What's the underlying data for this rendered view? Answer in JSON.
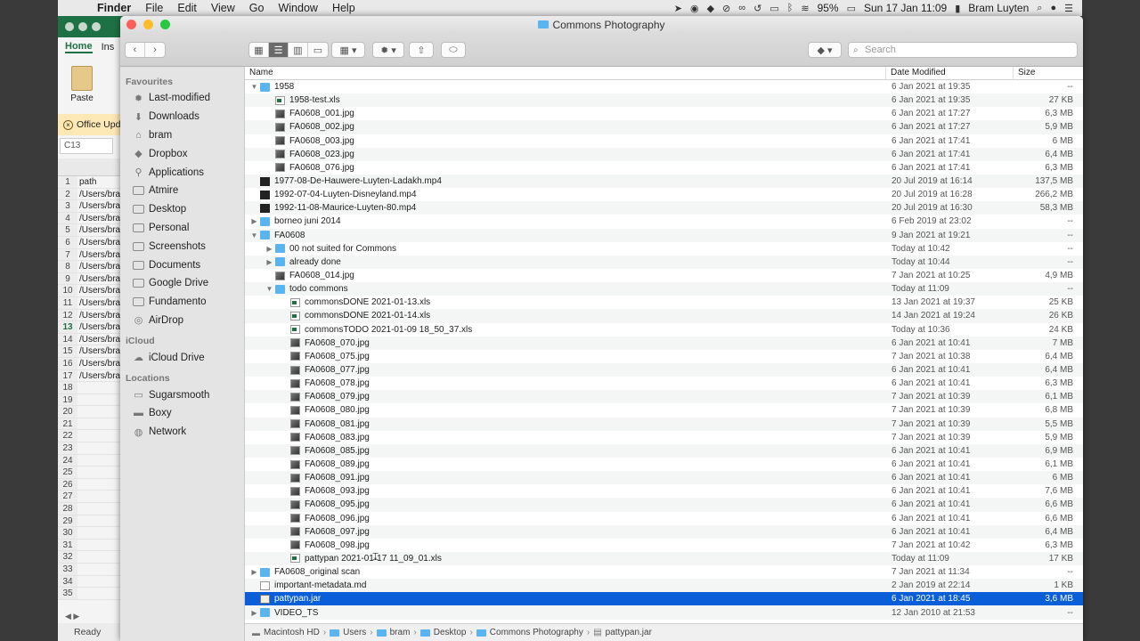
{
  "menubar": {
    "app": "Finder",
    "items": [
      "File",
      "Edit",
      "View",
      "Go",
      "Window",
      "Help"
    ],
    "battery": "95%",
    "clock": "Sun 17 Jan  11:09",
    "user": "Bram Luyten"
  },
  "excel": {
    "tabs": [
      "Home",
      "Ins"
    ],
    "paste_label": "Paste",
    "notice": "Office Upd",
    "namebox": "C13",
    "rows": [
      {
        "n": "1",
        "v": "path"
      },
      {
        "n": "2",
        "v": "/Users/bra"
      },
      {
        "n": "3",
        "v": "/Users/bra"
      },
      {
        "n": "4",
        "v": "/Users/bra"
      },
      {
        "n": "5",
        "v": "/Users/bra"
      },
      {
        "n": "6",
        "v": "/Users/bra"
      },
      {
        "n": "7",
        "v": "/Users/bra"
      },
      {
        "n": "8",
        "v": "/Users/bra"
      },
      {
        "n": "9",
        "v": "/Users/bra"
      },
      {
        "n": "10",
        "v": "/Users/bra"
      },
      {
        "n": "11",
        "v": "/Users/bra"
      },
      {
        "n": "12",
        "v": "/Users/bra"
      },
      {
        "n": "13",
        "v": "/Users/bra"
      },
      {
        "n": "14",
        "v": "/Users/bra"
      },
      {
        "n": "15",
        "v": "/Users/bra"
      },
      {
        "n": "16",
        "v": "/Users/bra"
      },
      {
        "n": "17",
        "v": "/Users/bra"
      },
      {
        "n": "18",
        "v": ""
      },
      {
        "n": "19",
        "v": ""
      },
      {
        "n": "20",
        "v": ""
      },
      {
        "n": "21",
        "v": ""
      },
      {
        "n": "22",
        "v": ""
      },
      {
        "n": "23",
        "v": ""
      },
      {
        "n": "24",
        "v": ""
      },
      {
        "n": "25",
        "v": ""
      },
      {
        "n": "26",
        "v": ""
      },
      {
        "n": "27",
        "v": ""
      },
      {
        "n": "28",
        "v": ""
      },
      {
        "n": "29",
        "v": ""
      },
      {
        "n": "30",
        "v": ""
      },
      {
        "n": "31",
        "v": ""
      },
      {
        "n": "32",
        "v": ""
      },
      {
        "n": "33",
        "v": ""
      },
      {
        "n": "34",
        "v": ""
      },
      {
        "n": "35",
        "v": ""
      }
    ],
    "status": "Ready"
  },
  "window": {
    "title": "Commons Photography",
    "search_placeholder": "Search"
  },
  "sidebar": {
    "sections": [
      {
        "title": "Favourites",
        "items": [
          {
            "label": "Last-modified",
            "icon": "gear-icon"
          },
          {
            "label": "Downloads",
            "icon": "download-icon"
          },
          {
            "label": "bram",
            "icon": "home-icon"
          },
          {
            "label": "Dropbox",
            "icon": "dropbox-icon"
          },
          {
            "label": "Applications",
            "icon": "applications-icon"
          },
          {
            "label": "Atmire",
            "icon": "folder-icon"
          },
          {
            "label": "Desktop",
            "icon": "folder-icon"
          },
          {
            "label": "Personal",
            "icon": "folder-icon"
          },
          {
            "label": "Screenshots",
            "icon": "folder-icon"
          },
          {
            "label": "Documents",
            "icon": "folder-icon"
          },
          {
            "label": "Google Drive",
            "icon": "folder-icon"
          },
          {
            "label": "Fundamento",
            "icon": "folder-icon"
          },
          {
            "label": "AirDrop",
            "icon": "airdrop-icon"
          }
        ]
      },
      {
        "title": "iCloud",
        "items": [
          {
            "label": "iCloud Drive",
            "icon": "cloud-icon"
          }
        ]
      },
      {
        "title": "Locations",
        "items": [
          {
            "label": "Sugarsmooth",
            "icon": "laptop-icon"
          },
          {
            "label": "Boxy",
            "icon": "disk-icon"
          },
          {
            "label": "Network",
            "icon": "network-icon"
          }
        ]
      }
    ]
  },
  "columns": {
    "name": "Name",
    "date": "Date Modified",
    "size": "Size"
  },
  "files": [
    {
      "level": 0,
      "tri": "open",
      "kind": "folder",
      "name": "1958",
      "date": "6 Jan 2021 at 19:35",
      "size": "--"
    },
    {
      "level": 1,
      "tri": "",
      "kind": "xls",
      "name": "1958-test.xls",
      "date": "6 Jan 2021 at 19:35",
      "size": "27 KB"
    },
    {
      "level": 1,
      "tri": "",
      "kind": "img",
      "name": "FA0608_001.jpg",
      "date": "6 Jan 2021 at 17:27",
      "size": "6,3 MB"
    },
    {
      "level": 1,
      "tri": "",
      "kind": "img",
      "name": "FA0608_002.jpg",
      "date": "6 Jan 2021 at 17:27",
      "size": "5,9 MB"
    },
    {
      "level": 1,
      "tri": "",
      "kind": "img",
      "name": "FA0608_003.jpg",
      "date": "6 Jan 2021 at 17:41",
      "size": "6 MB"
    },
    {
      "level": 1,
      "tri": "",
      "kind": "img",
      "name": "FA0608_023.jpg",
      "date": "6 Jan 2021 at 17:41",
      "size": "6,4 MB"
    },
    {
      "level": 1,
      "tri": "",
      "kind": "img",
      "name": "FA0608_076.jpg",
      "date": "6 Jan 2021 at 17:41",
      "size": "6,3 MB"
    },
    {
      "level": 0,
      "tri": "",
      "kind": "video",
      "name": "1977-08-De-Hauwere-Luyten-Ladakh.mp4",
      "date": "20 Jul 2019 at 16:14",
      "size": "137,5 MB"
    },
    {
      "level": 0,
      "tri": "",
      "kind": "video",
      "name": "1992-07-04-Luyten-Disneyland.mp4",
      "date": "20 Jul 2019 at 16:28",
      "size": "266,2 MB"
    },
    {
      "level": 0,
      "tri": "",
      "kind": "video",
      "name": "1992-11-08-Maurice-Luyten-80.mp4",
      "date": "20 Jul 2019 at 16:30",
      "size": "58,3 MB"
    },
    {
      "level": 0,
      "tri": "closed",
      "kind": "folder",
      "name": "borneo juni 2014",
      "date": "6 Feb 2019 at 23:02",
      "size": "--"
    },
    {
      "level": 0,
      "tri": "open",
      "kind": "folder",
      "name": "FA0608",
      "date": "9 Jan 2021 at 19:21",
      "size": "--"
    },
    {
      "level": 1,
      "tri": "closed",
      "kind": "folder",
      "name": "00 not suited for Commons",
      "date": "Today at 10:42",
      "size": "--"
    },
    {
      "level": 1,
      "tri": "closed",
      "kind": "folder",
      "name": "already done",
      "date": "Today at 10:44",
      "size": "--"
    },
    {
      "level": 1,
      "tri": "",
      "kind": "img",
      "name": "FA0608_014.jpg",
      "date": "7 Jan 2021 at 10:25",
      "size": "4,9 MB"
    },
    {
      "level": 1,
      "tri": "open",
      "kind": "folder",
      "name": "todo commons",
      "date": "Today at 11:09",
      "size": "--"
    },
    {
      "level": 2,
      "tri": "",
      "kind": "xls",
      "name": "commonsDONE 2021-01-13.xls",
      "date": "13 Jan 2021 at 19:37",
      "size": "25 KB"
    },
    {
      "level": 2,
      "tri": "",
      "kind": "xls",
      "name": "commonsDONE 2021-01-14.xls",
      "date": "14 Jan 2021 at 19:24",
      "size": "26 KB"
    },
    {
      "level": 2,
      "tri": "",
      "kind": "xls",
      "name": "commonsTODO 2021-01-09 18_50_37.xls",
      "date": "Today at 10:36",
      "size": "24 KB"
    },
    {
      "level": 2,
      "tri": "",
      "kind": "img",
      "name": "FA0608_070.jpg",
      "date": "6 Jan 2021 at 10:41",
      "size": "7 MB"
    },
    {
      "level": 2,
      "tri": "",
      "kind": "img",
      "name": "FA0608_075.jpg",
      "date": "7 Jan 2021 at 10:38",
      "size": "6,4 MB"
    },
    {
      "level": 2,
      "tri": "",
      "kind": "img",
      "name": "FA0608_077.jpg",
      "date": "6 Jan 2021 at 10:41",
      "size": "6,4 MB"
    },
    {
      "level": 2,
      "tri": "",
      "kind": "img",
      "name": "FA0608_078.jpg",
      "date": "6 Jan 2021 at 10:41",
      "size": "6,3 MB"
    },
    {
      "level": 2,
      "tri": "",
      "kind": "img",
      "name": "FA0608_079.jpg",
      "date": "7 Jan 2021 at 10:39",
      "size": "6,1 MB"
    },
    {
      "level": 2,
      "tri": "",
      "kind": "img",
      "name": "FA0608_080.jpg",
      "date": "7 Jan 2021 at 10:39",
      "size": "6,8 MB"
    },
    {
      "level": 2,
      "tri": "",
      "kind": "img",
      "name": "FA0608_081.jpg",
      "date": "7 Jan 2021 at 10:39",
      "size": "5,5 MB"
    },
    {
      "level": 2,
      "tri": "",
      "kind": "img",
      "name": "FA0608_083.jpg",
      "date": "7 Jan 2021 at 10:39",
      "size": "5,9 MB"
    },
    {
      "level": 2,
      "tri": "",
      "kind": "img",
      "name": "FA0608_085.jpg",
      "date": "6 Jan 2021 at 10:41",
      "size": "6,9 MB"
    },
    {
      "level": 2,
      "tri": "",
      "kind": "img",
      "name": "FA0608_089.jpg",
      "date": "6 Jan 2021 at 10:41",
      "size": "6,1 MB"
    },
    {
      "level": 2,
      "tri": "",
      "kind": "img",
      "name": "FA0608_091.jpg",
      "date": "6 Jan 2021 at 10:41",
      "size": "6 MB"
    },
    {
      "level": 2,
      "tri": "",
      "kind": "img",
      "name": "FA0608_093.jpg",
      "date": "6 Jan 2021 at 10:41",
      "size": "7,6 MB"
    },
    {
      "level": 2,
      "tri": "",
      "kind": "img",
      "name": "FA0608_095.jpg",
      "date": "6 Jan 2021 at 10:41",
      "size": "6,6 MB"
    },
    {
      "level": 2,
      "tri": "",
      "kind": "img",
      "name": "FA0608_096.jpg",
      "date": "6 Jan 2021 at 10:41",
      "size": "6,6 MB"
    },
    {
      "level": 2,
      "tri": "",
      "kind": "img",
      "name": "FA0608_097.jpg",
      "date": "6 Jan 2021 at 10:41",
      "size": "6,4 MB"
    },
    {
      "level": 2,
      "tri": "",
      "kind": "img",
      "name": "FA0608_098.jpg",
      "date": "7 Jan 2021 at 10:42",
      "size": "6,3 MB"
    },
    {
      "level": 2,
      "tri": "",
      "kind": "xls",
      "name": "pattypan 2021-01-17 11_09_01.xls",
      "date": "Today at 11:09",
      "size": "17 KB"
    },
    {
      "level": 0,
      "tri": "closed",
      "kind": "folder",
      "name": "FA0608_original scan",
      "date": "7 Jan 2021 at 11:34",
      "size": "--"
    },
    {
      "level": 0,
      "tri": "",
      "kind": "doc",
      "name": "important-metadata.md",
      "date": "2 Jan 2019 at 22:14",
      "size": "1 KB"
    },
    {
      "level": 0,
      "tri": "",
      "kind": "jar",
      "name": "pattypan.jar",
      "date": "6 Jan 2021 at 18:45",
      "size": "3,6 MB",
      "selected": true
    },
    {
      "level": 0,
      "tri": "closed",
      "kind": "folder",
      "name": "VIDEO_TS",
      "date": "12 Jan 2010 at 21:53",
      "size": "--"
    }
  ],
  "pathbar": [
    "Macintosh HD",
    "Users",
    "bram",
    "Desktop",
    "Commons Photography",
    "pattypan.jar"
  ],
  "colors": {
    "selection": "#0a5fd8",
    "folder": "#5ab4f0",
    "excel_green": "#1e7145"
  }
}
